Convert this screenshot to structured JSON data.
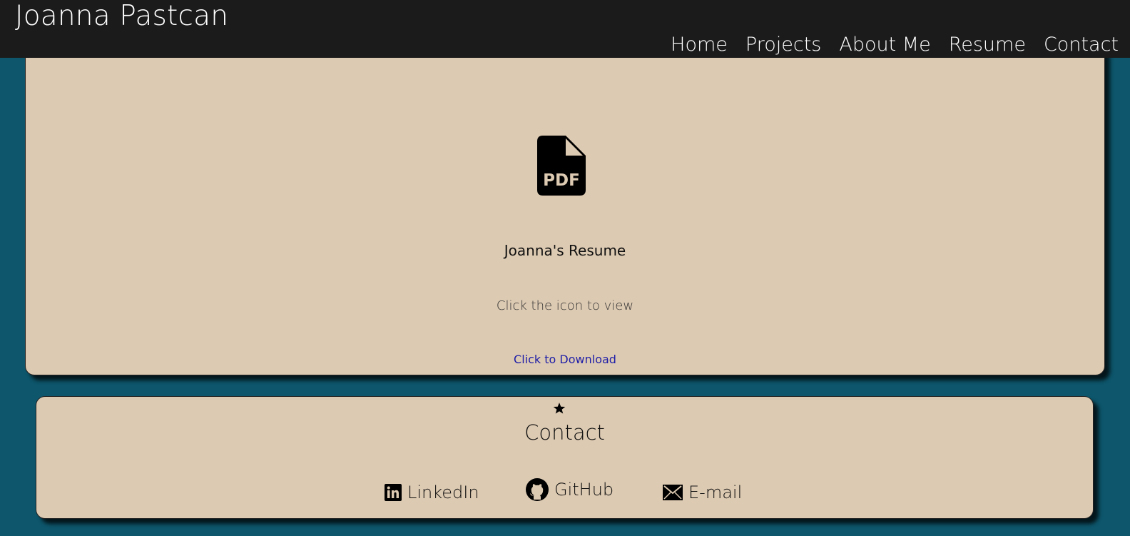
{
  "header": {
    "brand": "Joanna Pastcan",
    "nav": [
      "Home",
      "Projects",
      "About Me",
      "Resume",
      "Contact"
    ]
  },
  "resume": {
    "icon": "pdf-file-icon",
    "icon_text": "PDF",
    "title": "Joanna's Resume",
    "hint": "Click the icon to view",
    "download_label": "Click to Download"
  },
  "contact": {
    "icon": "star-icon",
    "heading": "Contact",
    "links": [
      {
        "label": "LinkedIn",
        "icon": "linkedin-icon"
      },
      {
        "label": "GitHub",
        "icon": "github-icon"
      },
      {
        "label": "E-mail",
        "icon": "envelope-icon"
      }
    ]
  },
  "colors": {
    "page_background": "#0d566c",
    "navbar": "#1b1b1b",
    "card": "#ddcab2",
    "link": "#1f1fa8"
  }
}
